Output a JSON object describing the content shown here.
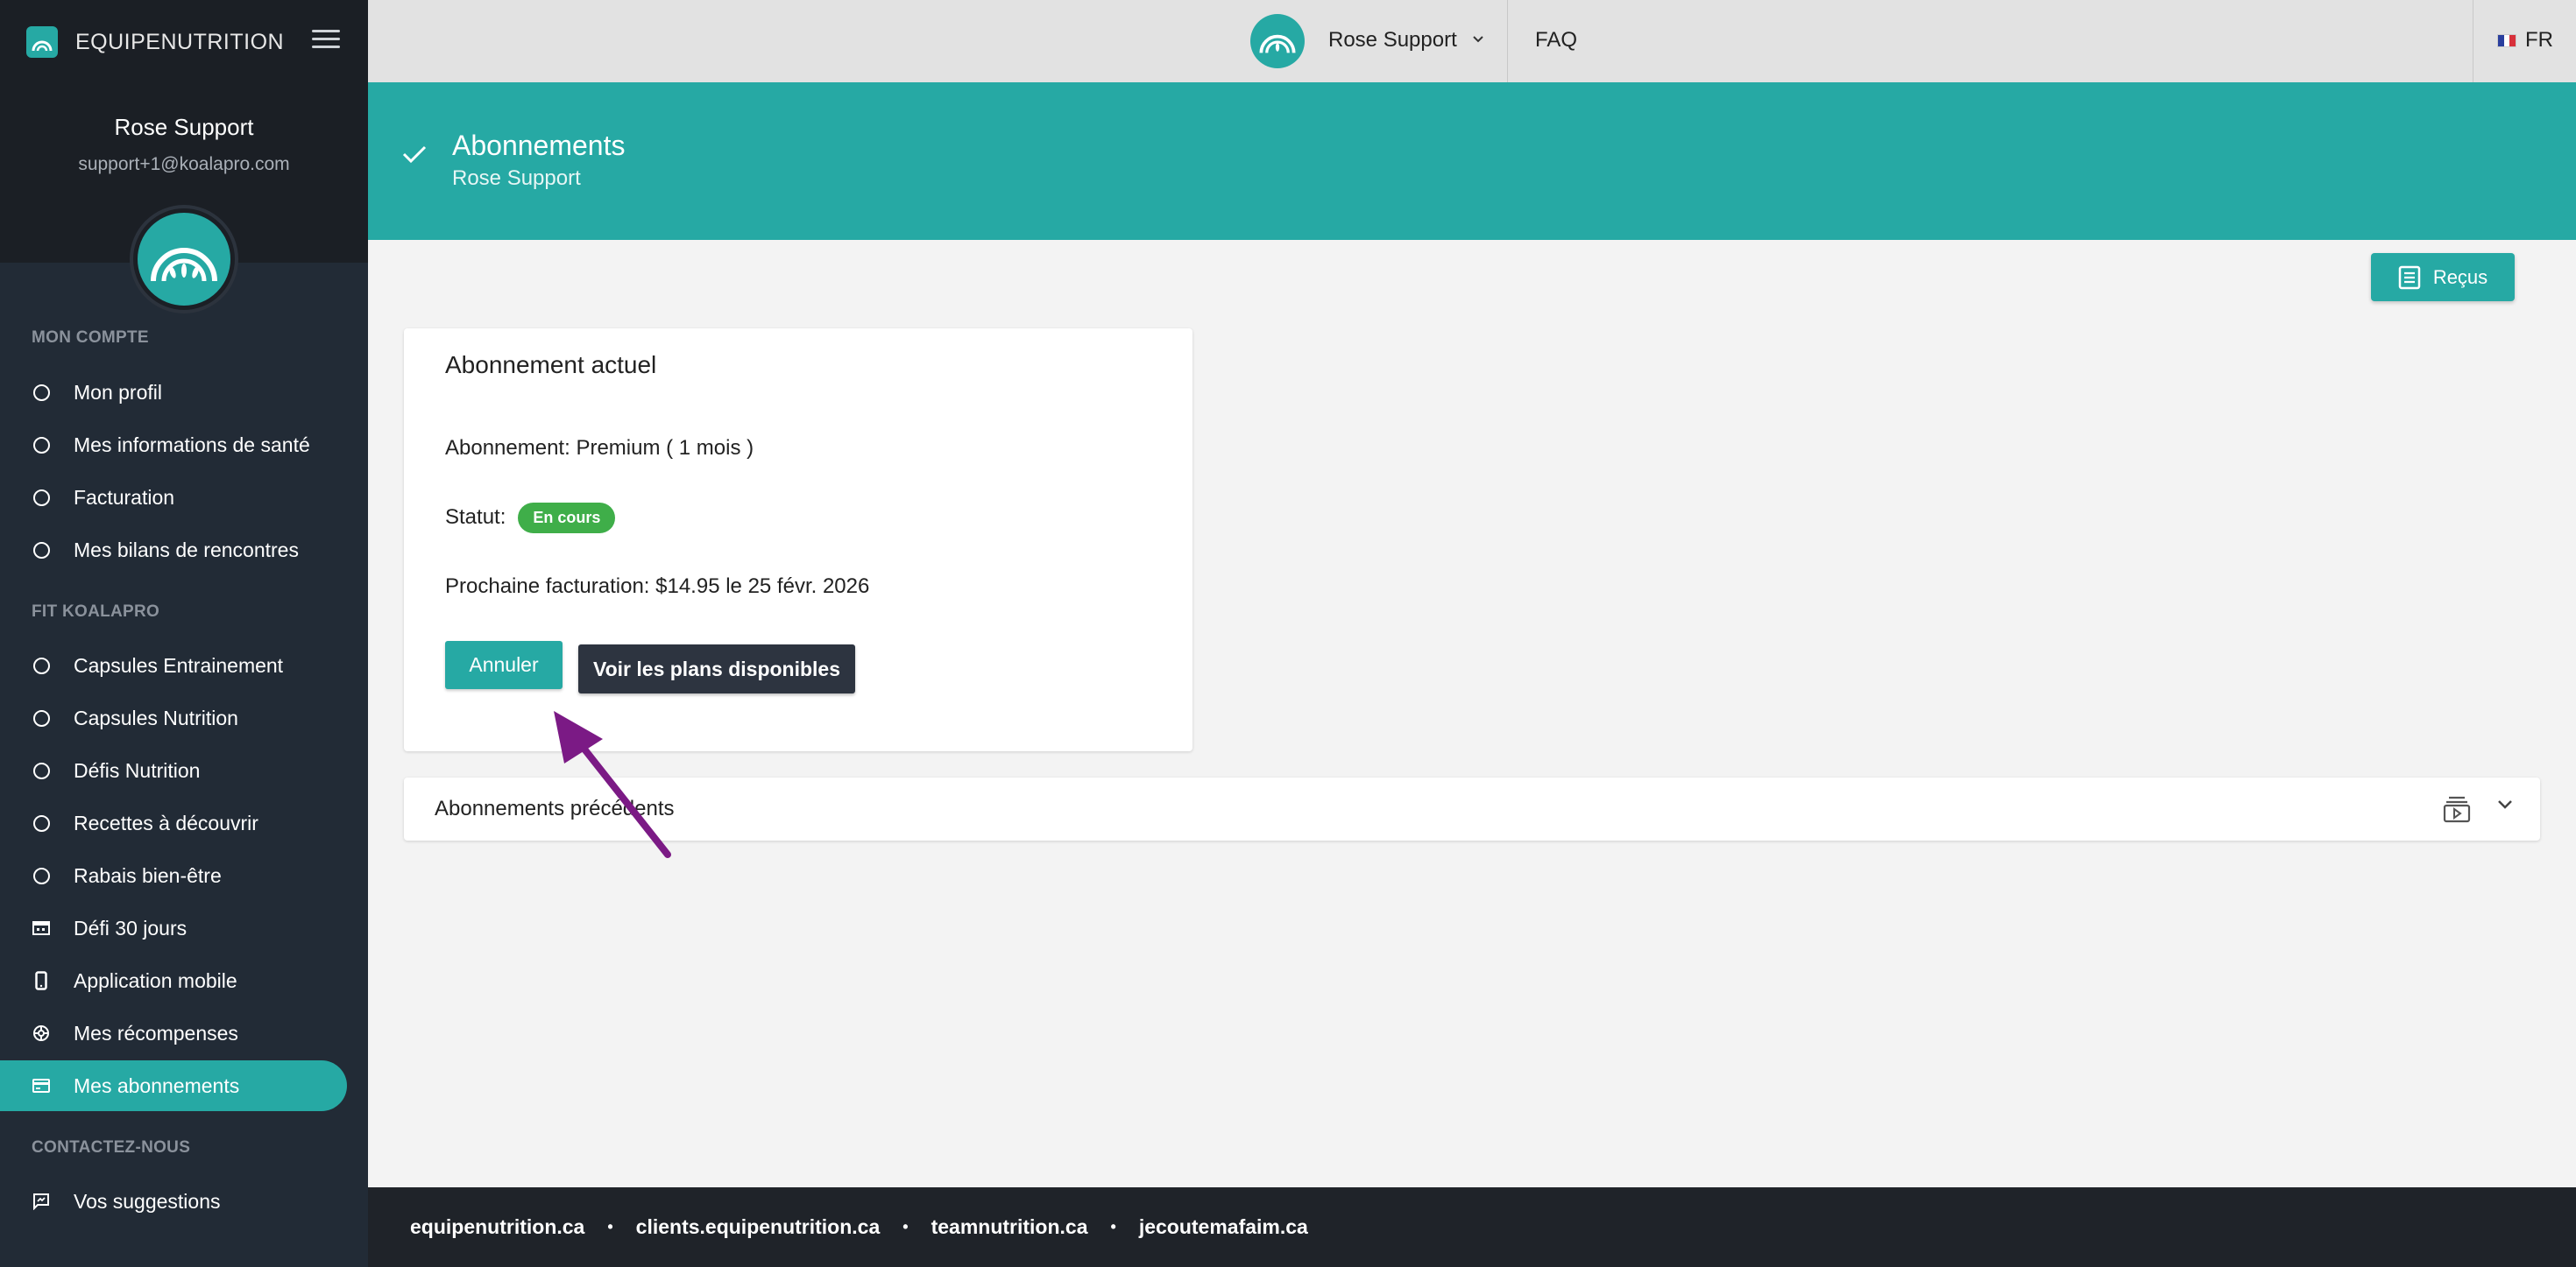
{
  "brand": {
    "name": "EQUIPENUTRITION"
  },
  "sidebar": {
    "user_name": "Rose Support",
    "user_email": "support+1@koalapro.com",
    "sections": [
      {
        "title": "MON COMPTE",
        "items": [
          {
            "label": "Mon profil",
            "icon": "circle-icon"
          },
          {
            "label": "Mes informations de santé",
            "icon": "circle-icon"
          },
          {
            "label": "Facturation",
            "icon": "circle-icon"
          },
          {
            "label": "Mes bilans de rencontres",
            "icon": "circle-icon"
          }
        ]
      },
      {
        "title": "FIT KOALAPRO",
        "items": [
          {
            "label": "Capsules Entrainement",
            "icon": "circle-icon"
          },
          {
            "label": "Capsules Nutrition",
            "icon": "circle-icon"
          },
          {
            "label": "Défis Nutrition",
            "icon": "circle-icon"
          },
          {
            "label": "Recettes à découvrir",
            "icon": "circle-icon"
          },
          {
            "label": "Rabais bien-être",
            "icon": "circle-icon"
          },
          {
            "label": "Défi 30 jours",
            "icon": "calendar-icon"
          },
          {
            "label": "Application mobile",
            "icon": "phone-icon"
          },
          {
            "label": "Mes récompenses",
            "icon": "award-icon"
          },
          {
            "label": "Mes abonnements",
            "icon": "card-icon",
            "active": true
          }
        ]
      },
      {
        "title": "CONTACTEZ-NOUS",
        "items": [
          {
            "label": "Vos suggestions",
            "icon": "feedback-icon"
          }
        ]
      }
    ]
  },
  "topbar": {
    "user_name": "Rose Support",
    "faq": "FAQ",
    "lang": "FR"
  },
  "header": {
    "title": "Abonnements",
    "subtitle": "Rose Support"
  },
  "recus_button": "Reçus",
  "card": {
    "title": "Abonnement actuel",
    "plan": "Abonnement: Premium ( 1 mois )",
    "status_label": "Statut:",
    "status_badge": "En cours",
    "next_billing": "Prochaine facturation: $14.95 le 25 févr. 2026",
    "cancel_button": "Annuler",
    "plans_button": "Voir les plans disponibles"
  },
  "accordion": {
    "title": "Abonnements précédents"
  },
  "footer": {
    "links": [
      "equipenutrition.ca",
      "clients.equipenutrition.ca",
      "teamnutrition.ca",
      "jecoutemafaim.ca"
    ]
  },
  "colors": {
    "accent": "#26a9a4",
    "sidebar": "#222b36",
    "success": "#3fae49",
    "annotation": "#7b1a85"
  }
}
